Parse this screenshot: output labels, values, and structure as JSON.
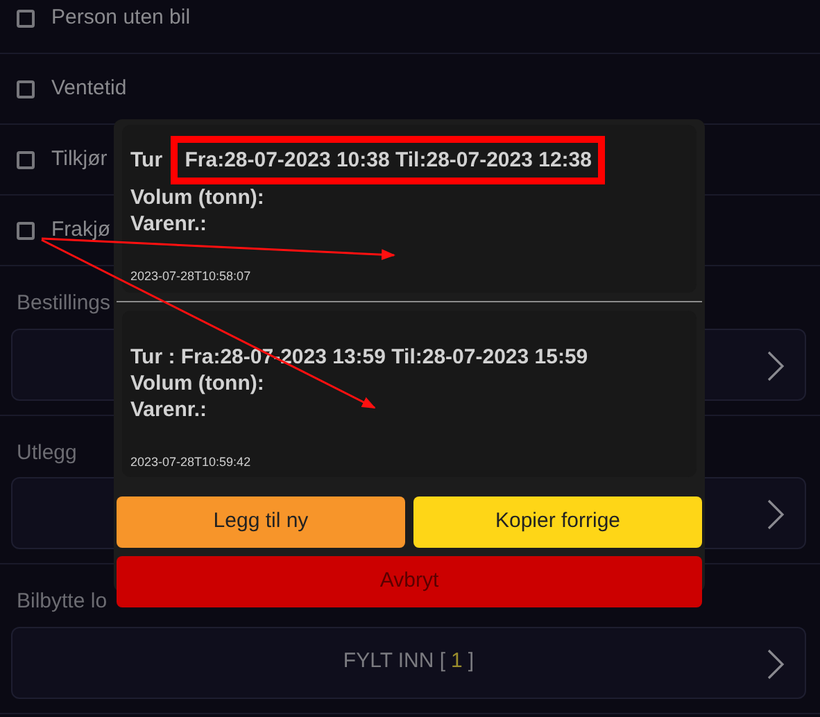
{
  "options": [
    {
      "label": "Person uten bil",
      "checked": false
    },
    {
      "label": "Ventetid",
      "checked": false
    },
    {
      "label": "Tilkjør",
      "checked": false
    },
    {
      "label": "Frakjø",
      "checked": false
    }
  ],
  "sections": [
    {
      "label": "Bestillings"
    },
    {
      "label": "Utlegg"
    },
    {
      "label": "Bilbytte lo",
      "button": {
        "text_before": "FYLT INN [",
        "count": "1",
        "text_after": "]"
      }
    }
  ],
  "dialog": {
    "entries": [
      {
        "trip_prefix": "Tur",
        "trip_highlight": "Fra:28-07-2023 10:38 Til:28-07-2023 12:38",
        "volume": "Volum (tonn):",
        "item": "Varenr.:",
        "timestamp": "2023-07-28T10:58:07"
      },
      {
        "trip_prefix": "Tur : Fra:28-07-2023 13:59 Til:28-07-2023 15:59",
        "volume": "Volum (tonn):",
        "item": "Varenr.:",
        "timestamp": "2023-07-28T10:59:42"
      }
    ],
    "buttons": [
      {
        "label": "Legg til ny",
        "kind": "orange"
      },
      {
        "label": "Kopier forrige",
        "kind": "yellow"
      },
      {
        "label": "Avbryt",
        "kind": "red"
      }
    ]
  }
}
